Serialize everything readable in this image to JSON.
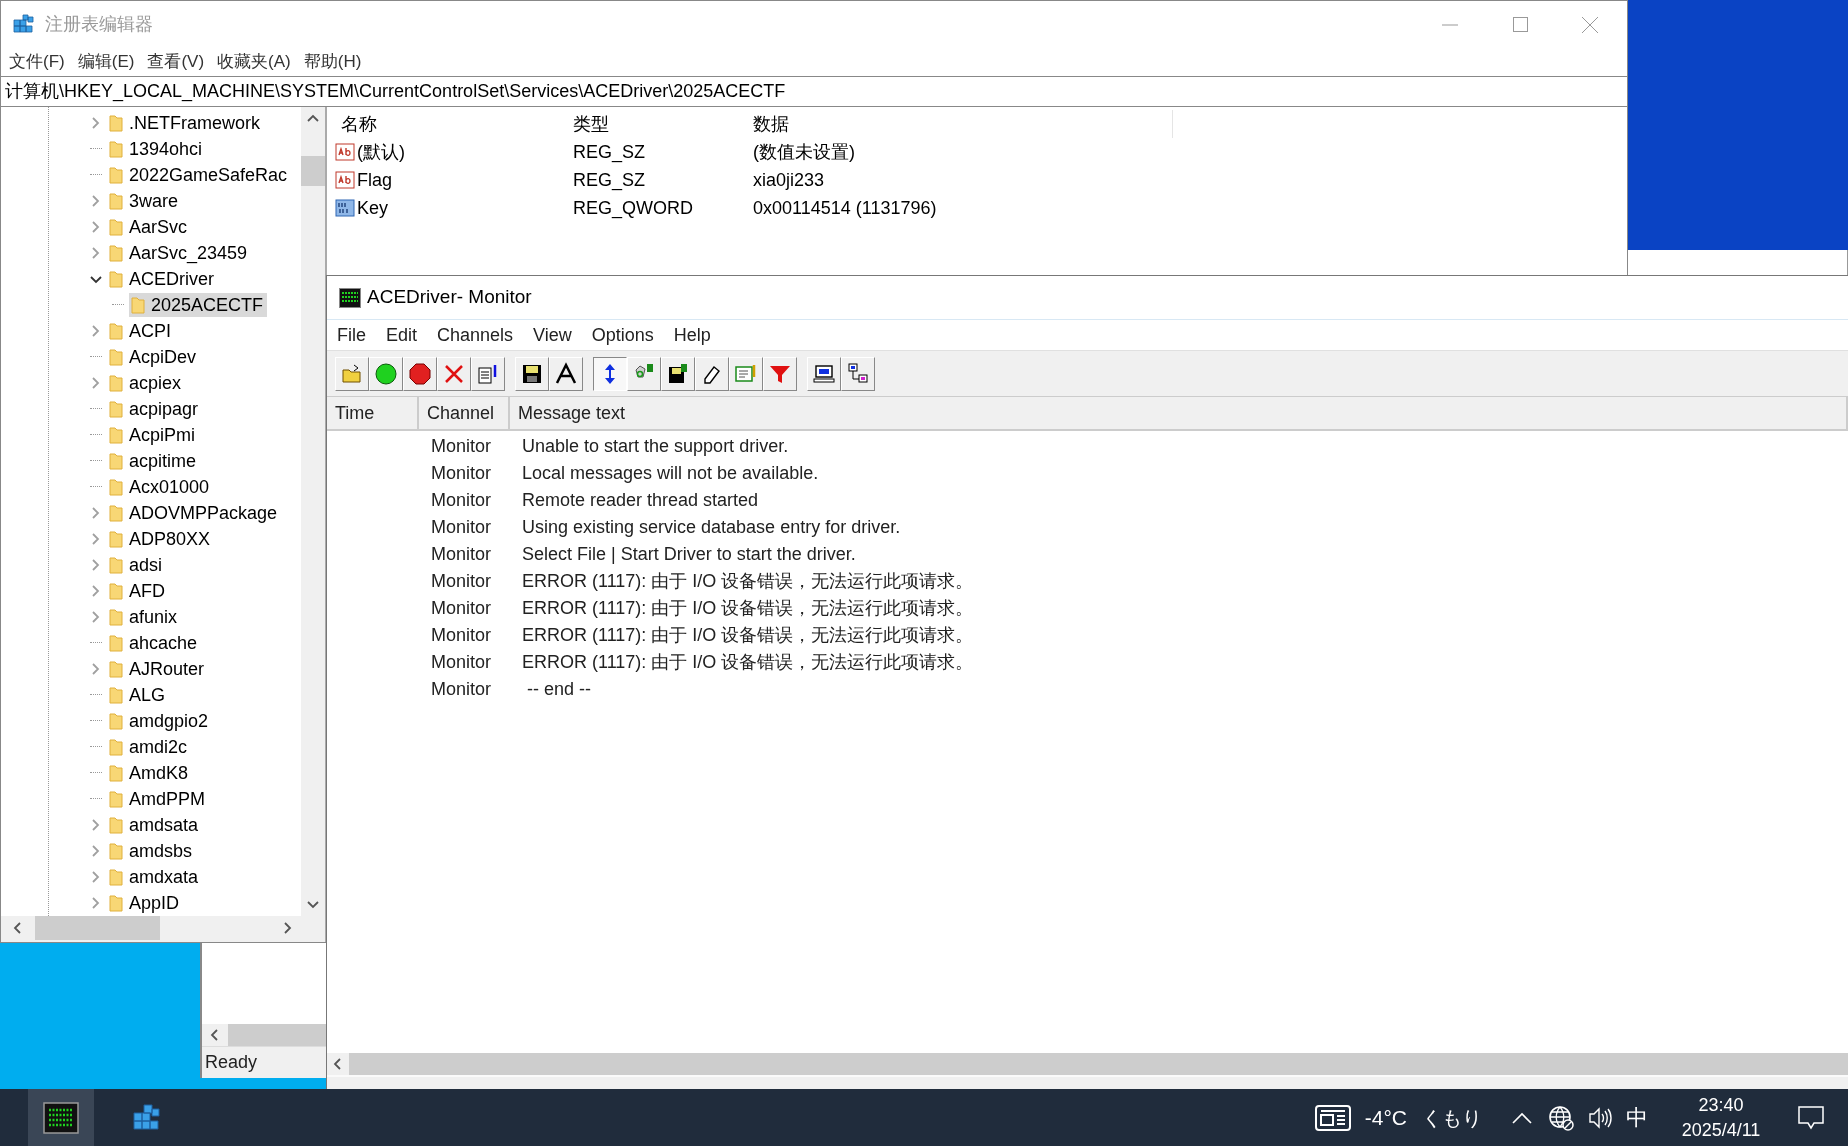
{
  "regedit": {
    "title": "注册表编辑器",
    "menu": [
      "文件(F)",
      "编辑(E)",
      "查看(V)",
      "收藏夹(A)",
      "帮助(H)"
    ],
    "address": "计算机\\HKEY_LOCAL_MACHINE\\SYSTEM\\CurrentControlSet\\Services\\ACEDriver\\2025ACECTF",
    "tree": [
      {
        "label": ".NETFramework",
        "kind": "collapsed",
        "selected": false
      },
      {
        "label": "1394ohci",
        "kind": "leaf",
        "selected": false
      },
      {
        "label": "2022GameSafeRac",
        "kind": "leaf",
        "selected": false
      },
      {
        "label": "3ware",
        "kind": "collapsed",
        "selected": false
      },
      {
        "label": "AarSvc",
        "kind": "collapsed",
        "selected": false
      },
      {
        "label": "AarSvc_23459",
        "kind": "collapsed",
        "selected": false
      },
      {
        "label": "ACEDriver",
        "kind": "expanded",
        "selected": false,
        "children": [
          {
            "label": "2025ACECTF",
            "kind": "leaf",
            "selected": true
          }
        ]
      },
      {
        "label": "ACPI",
        "kind": "collapsed",
        "selected": false
      },
      {
        "label": "AcpiDev",
        "kind": "leaf",
        "selected": false
      },
      {
        "label": "acpiex",
        "kind": "collapsed",
        "selected": false
      },
      {
        "label": "acpipagr",
        "kind": "leaf",
        "selected": false
      },
      {
        "label": "AcpiPmi",
        "kind": "leaf",
        "selected": false
      },
      {
        "label": "acpitime",
        "kind": "leaf",
        "selected": false
      },
      {
        "label": "Acx01000",
        "kind": "leaf",
        "selected": false
      },
      {
        "label": "ADOVMPPackage",
        "kind": "collapsed",
        "selected": false
      },
      {
        "label": "ADP80XX",
        "kind": "collapsed",
        "selected": false
      },
      {
        "label": "adsi",
        "kind": "collapsed",
        "selected": false
      },
      {
        "label": "AFD",
        "kind": "collapsed",
        "selected": false
      },
      {
        "label": "afunix",
        "kind": "collapsed",
        "selected": false
      },
      {
        "label": "ahcache",
        "kind": "leaf",
        "selected": false
      },
      {
        "label": "AJRouter",
        "kind": "collapsed",
        "selected": false
      },
      {
        "label": "ALG",
        "kind": "leaf",
        "selected": false
      },
      {
        "label": "amdgpio2",
        "kind": "leaf",
        "selected": false
      },
      {
        "label": "amdi2c",
        "kind": "leaf",
        "selected": false
      },
      {
        "label": "AmdK8",
        "kind": "leaf",
        "selected": false
      },
      {
        "label": "AmdPPM",
        "kind": "leaf",
        "selected": false
      },
      {
        "label": "amdsata",
        "kind": "collapsed",
        "selected": false
      },
      {
        "label": "amdsbs",
        "kind": "collapsed",
        "selected": false
      },
      {
        "label": "amdxata",
        "kind": "collapsed",
        "selected": false
      },
      {
        "label": "AppID",
        "kind": "collapsed",
        "selected": false
      }
    ],
    "values": {
      "columns": [
        "名称",
        "类型",
        "数据"
      ],
      "rows": [
        {
          "kind": "string",
          "name": "(默认)",
          "type": "REG_SZ",
          "data": "(数值未设置)"
        },
        {
          "kind": "string",
          "name": "Flag",
          "type": "REG_SZ",
          "data": "xia0ji233"
        },
        {
          "kind": "binary",
          "name": "Key",
          "type": "REG_QWORD",
          "data": "0x00114514 (1131796)"
        }
      ]
    }
  },
  "back_window": {
    "status": "Ready"
  },
  "monitor": {
    "title": "ACEDriver- Monitor",
    "menu": [
      "File",
      "Edit",
      "Channels",
      "View",
      "Options",
      "Help"
    ],
    "toolbar": [
      {
        "pressed": false
      },
      {
        "pressed": false
      },
      {
        "pressed": false
      },
      {
        "pressed": false
      },
      {
        "pressed": false
      },
      {
        "pressed": false
      },
      {
        "pressed": false
      },
      {
        "pressed": true
      },
      {
        "pressed": false
      },
      {
        "pressed": false
      },
      {
        "pressed": false
      },
      {
        "pressed": false
      },
      {
        "pressed": false
      },
      {
        "pressed": false
      },
      {
        "pressed": false
      }
    ],
    "columns": [
      "Time",
      "Channel",
      "Message text"
    ],
    "messages": [
      {
        "channel": "Monitor",
        "text": "Unable to start the support driver."
      },
      {
        "channel": "Monitor",
        "text": "Local messages will not be available."
      },
      {
        "channel": "Monitor",
        "text": "Remote reader thread started"
      },
      {
        "channel": "Monitor",
        "text": "Using existing service database entry for driver."
      },
      {
        "channel": "Monitor",
        "text": "Select File | Start Driver to start the driver."
      },
      {
        "channel": "Monitor",
        "text": "ERROR (1117): 由于 I/O 设备错误，无法运行此项请求。"
      },
      {
        "channel": "Monitor",
        "text": "ERROR (1117): 由于 I/O 设备错误，无法运行此项请求。"
      },
      {
        "channel": "Monitor",
        "text": "ERROR (1117): 由于 I/O 设备错误，无法运行此项请求。"
      },
      {
        "channel": "Monitor",
        "text": "ERROR (1117): 由于 I/O 设备错误，无法运行此项请求。"
      },
      {
        "channel": "Monitor",
        "text": " -- end --"
      }
    ]
  },
  "taskbar": {
    "apps": [
      {
        "selected": true
      },
      {
        "selected": false
      }
    ],
    "temperature": "-4°C",
    "weather": "くもり",
    "ime": "中",
    "time": "23:40",
    "date": "2025/4/11"
  }
}
